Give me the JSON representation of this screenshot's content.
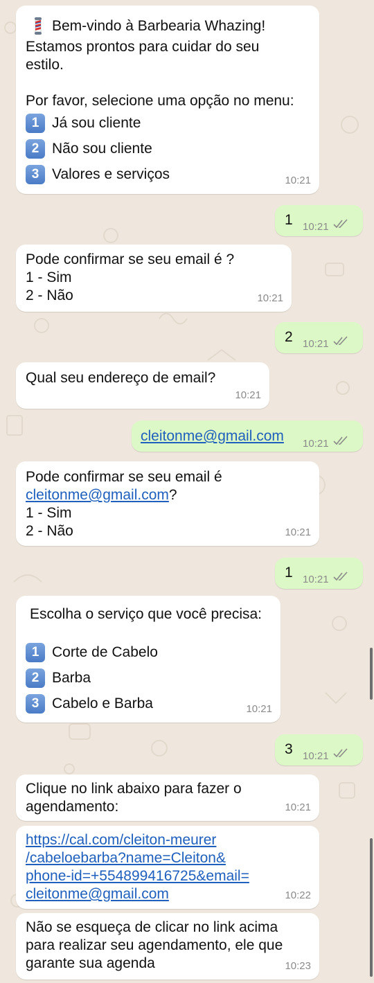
{
  "messages": [
    {
      "lines": [
        "Bem-vindo à Barbearia Whazing!",
        "Estamos prontos para cuidar do seu",
        "estilo.",
        "Por favor, selecione uma opção no menu:"
      ],
      "options": [
        "Já sou cliente",
        "Não sou cliente",
        "Valores e serviços"
      ],
      "time": "10:21"
    },
    {
      "text": "1",
      "time": "10:21"
    },
    {
      "lines": [
        "Pode confirmar se seu email é ?",
        "1 - Sim",
        "2 - Não"
      ],
      "time": "10:21"
    },
    {
      "text": "2",
      "time": "10:21"
    },
    {
      "lines": [
        "Qual seu endereço de email?"
      ],
      "time": "10:21"
    },
    {
      "link": "cleitonme@gmail.com",
      "time": "10:21"
    },
    {
      "line1": "Pode confirmar se seu email é",
      "link": "cleitonme@gmail.com",
      "after_link": "?",
      "lines": [
        "1 - Sim",
        "2 - Não"
      ],
      "time": "10:21"
    },
    {
      "text": "1",
      "time": "10:21"
    },
    {
      "lines": [
        "Escolha o serviço que você precisa:"
      ],
      "options": [
        "Corte de Cabelo",
        "Barba",
        "Cabelo e Barba"
      ],
      "time": "10:21"
    },
    {
      "text": "3",
      "time": "10:21"
    },
    {
      "lines": [
        "Clique no link abaixo para fazer o",
        "agendamento:"
      ],
      "time": "10:21"
    },
    {
      "link_lines": [
        "https://cal.com/cleiton-meurer",
        "/cabeloebarba?name=Cleiton&",
        "phone-id=+554899416725&email=",
        "cleitonme@gmail.com"
      ],
      "time": "10:22"
    },
    {
      "lines": [
        "Não se esqueça de clicar no link acima",
        "para realizar seu agendamento, ele que",
        "garante sua agenda"
      ],
      "time": "10:23"
    }
  ],
  "badges": [
    "1",
    "2",
    "3"
  ],
  "icons": {
    "barber_pole": "barber-pole-icon",
    "read_receipt": "double-check-icon"
  },
  "colors": {
    "background": "#efe7dd",
    "incoming": "#ffffff",
    "outgoing": "#dcf8c6",
    "link": "#1f5fbd",
    "read_ticks": "#8a8a8a"
  }
}
